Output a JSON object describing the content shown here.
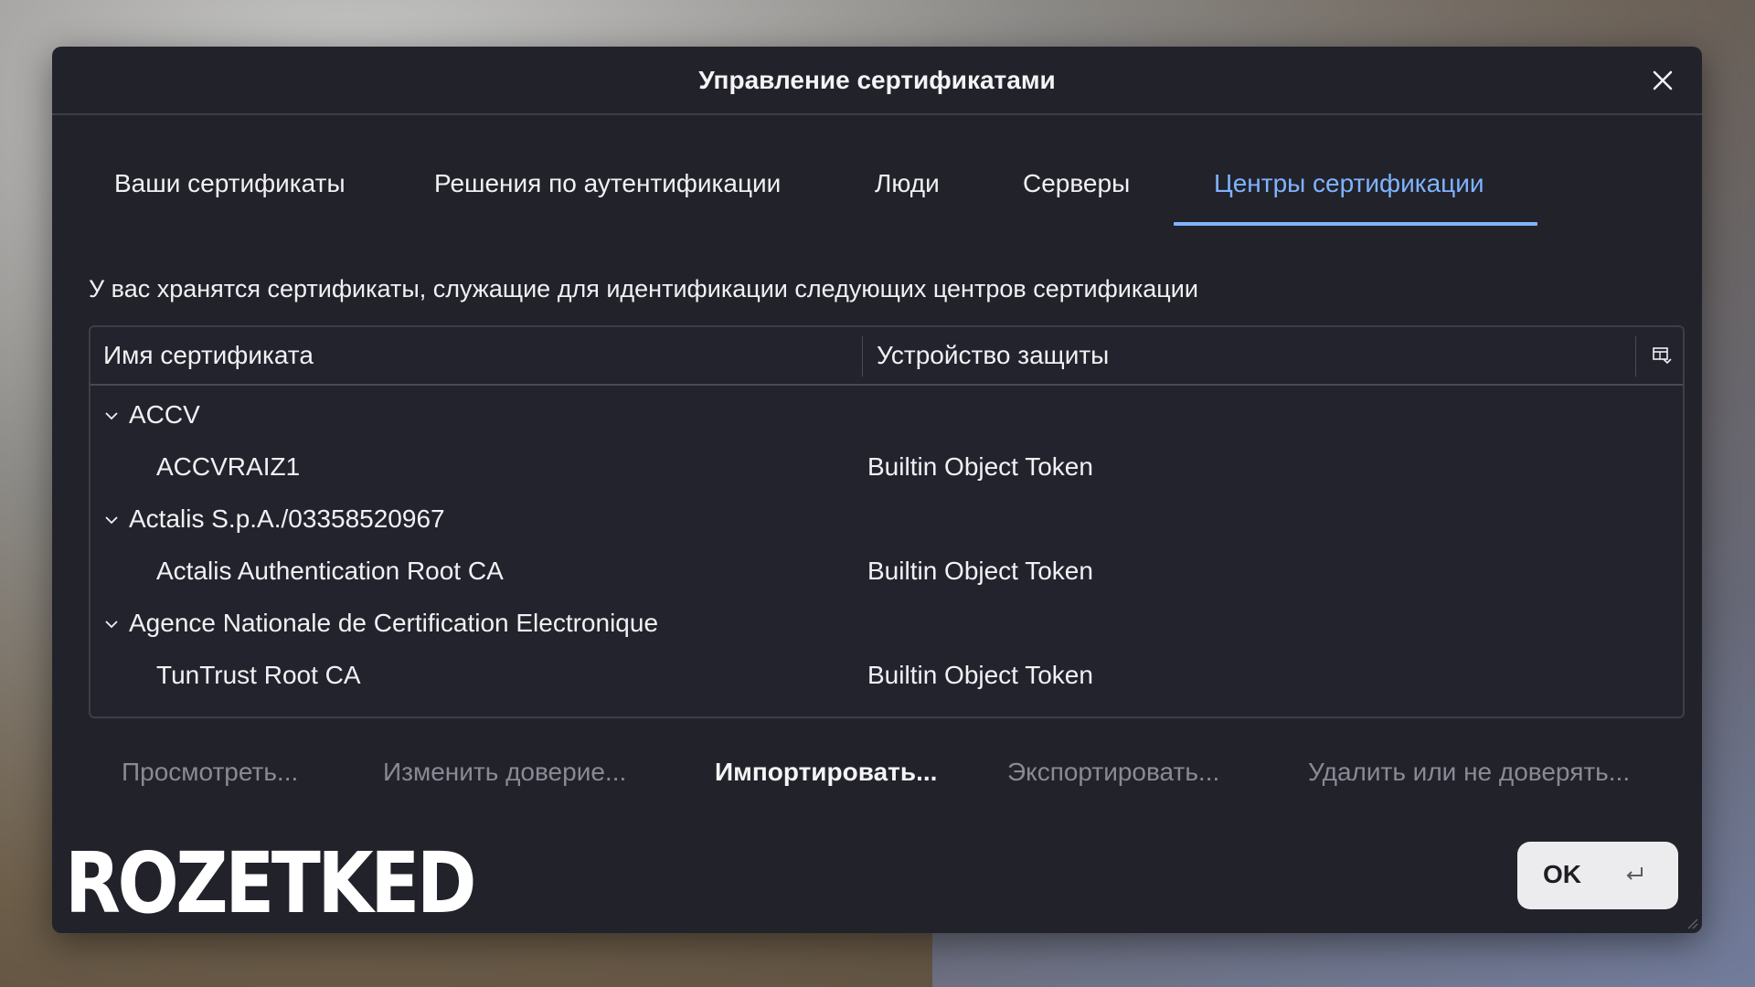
{
  "dialog": {
    "title": "Управление сертификатами"
  },
  "tabs": [
    {
      "label": "Ваши сертификаты",
      "active": false
    },
    {
      "label": "Решения по аутентификации",
      "active": false
    },
    {
      "label": "Люди",
      "active": false
    },
    {
      "label": "Серверы",
      "active": false
    },
    {
      "label": "Центры сертификации",
      "active": true
    }
  ],
  "description": "У вас хранятся сертификаты, служащие для идентификации следующих центров сертификации",
  "table": {
    "columns": [
      "Имя сертификата",
      "Устройство защиты"
    ],
    "rows": [
      {
        "type": "group",
        "name": "ACCV",
        "device": ""
      },
      {
        "type": "item",
        "name": "ACCVRAIZ1",
        "device": "Builtin Object Token"
      },
      {
        "type": "group",
        "name": "Actalis S.p.A./03358520967",
        "device": ""
      },
      {
        "type": "item",
        "name": "Actalis Authentication Root CA",
        "device": "Builtin Object Token"
      },
      {
        "type": "group",
        "name": "Agence Nationale de Certification Electronique",
        "device": ""
      },
      {
        "type": "item",
        "name": "TunTrust Root CA",
        "device": "Builtin Object Token"
      }
    ]
  },
  "actions": {
    "view": "Просмотреть...",
    "edit_trust": "Изменить доверие...",
    "import": "Импортировать...",
    "export": "Экспортировать...",
    "delete": "Удалить или не доверять..."
  },
  "ok_button": {
    "label": "OK"
  },
  "watermark": "ROZETKED",
  "colors": {
    "dialog_bg": "#22222b",
    "accent": "#7fb4ff",
    "text": "#f1f1f4",
    "disabled_text": "#8a8a95",
    "ok_bg": "#ececef"
  }
}
